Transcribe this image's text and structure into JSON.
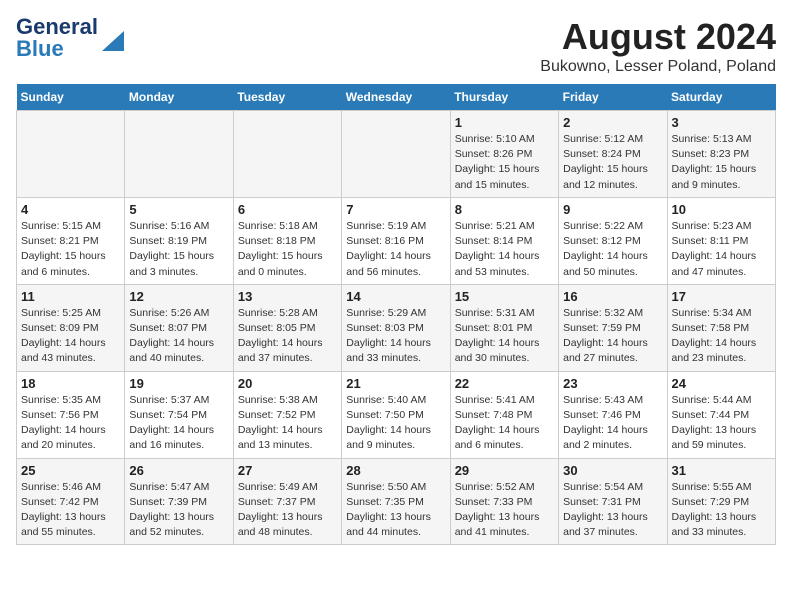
{
  "header": {
    "logo_line1": "General",
    "logo_line2": "Blue",
    "title": "August 2024",
    "subtitle": "Bukowno, Lesser Poland, Poland"
  },
  "weekdays": [
    "Sunday",
    "Monday",
    "Tuesday",
    "Wednesday",
    "Thursday",
    "Friday",
    "Saturday"
  ],
  "weeks": [
    [
      {
        "day": "",
        "info": ""
      },
      {
        "day": "",
        "info": ""
      },
      {
        "day": "",
        "info": ""
      },
      {
        "day": "",
        "info": ""
      },
      {
        "day": "1",
        "info": "Sunrise: 5:10 AM\nSunset: 8:26 PM\nDaylight: 15 hours\nand 15 minutes."
      },
      {
        "day": "2",
        "info": "Sunrise: 5:12 AM\nSunset: 8:24 PM\nDaylight: 15 hours\nand 12 minutes."
      },
      {
        "day": "3",
        "info": "Sunrise: 5:13 AM\nSunset: 8:23 PM\nDaylight: 15 hours\nand 9 minutes."
      }
    ],
    [
      {
        "day": "4",
        "info": "Sunrise: 5:15 AM\nSunset: 8:21 PM\nDaylight: 15 hours\nand 6 minutes."
      },
      {
        "day": "5",
        "info": "Sunrise: 5:16 AM\nSunset: 8:19 PM\nDaylight: 15 hours\nand 3 minutes."
      },
      {
        "day": "6",
        "info": "Sunrise: 5:18 AM\nSunset: 8:18 PM\nDaylight: 15 hours\nand 0 minutes."
      },
      {
        "day": "7",
        "info": "Sunrise: 5:19 AM\nSunset: 8:16 PM\nDaylight: 14 hours\nand 56 minutes."
      },
      {
        "day": "8",
        "info": "Sunrise: 5:21 AM\nSunset: 8:14 PM\nDaylight: 14 hours\nand 53 minutes."
      },
      {
        "day": "9",
        "info": "Sunrise: 5:22 AM\nSunset: 8:12 PM\nDaylight: 14 hours\nand 50 minutes."
      },
      {
        "day": "10",
        "info": "Sunrise: 5:23 AM\nSunset: 8:11 PM\nDaylight: 14 hours\nand 47 minutes."
      }
    ],
    [
      {
        "day": "11",
        "info": "Sunrise: 5:25 AM\nSunset: 8:09 PM\nDaylight: 14 hours\nand 43 minutes."
      },
      {
        "day": "12",
        "info": "Sunrise: 5:26 AM\nSunset: 8:07 PM\nDaylight: 14 hours\nand 40 minutes."
      },
      {
        "day": "13",
        "info": "Sunrise: 5:28 AM\nSunset: 8:05 PM\nDaylight: 14 hours\nand 37 minutes."
      },
      {
        "day": "14",
        "info": "Sunrise: 5:29 AM\nSunset: 8:03 PM\nDaylight: 14 hours\nand 33 minutes."
      },
      {
        "day": "15",
        "info": "Sunrise: 5:31 AM\nSunset: 8:01 PM\nDaylight: 14 hours\nand 30 minutes."
      },
      {
        "day": "16",
        "info": "Sunrise: 5:32 AM\nSunset: 7:59 PM\nDaylight: 14 hours\nand 27 minutes."
      },
      {
        "day": "17",
        "info": "Sunrise: 5:34 AM\nSunset: 7:58 PM\nDaylight: 14 hours\nand 23 minutes."
      }
    ],
    [
      {
        "day": "18",
        "info": "Sunrise: 5:35 AM\nSunset: 7:56 PM\nDaylight: 14 hours\nand 20 minutes."
      },
      {
        "day": "19",
        "info": "Sunrise: 5:37 AM\nSunset: 7:54 PM\nDaylight: 14 hours\nand 16 minutes."
      },
      {
        "day": "20",
        "info": "Sunrise: 5:38 AM\nSunset: 7:52 PM\nDaylight: 14 hours\nand 13 minutes."
      },
      {
        "day": "21",
        "info": "Sunrise: 5:40 AM\nSunset: 7:50 PM\nDaylight: 14 hours\nand 9 minutes."
      },
      {
        "day": "22",
        "info": "Sunrise: 5:41 AM\nSunset: 7:48 PM\nDaylight: 14 hours\nand 6 minutes."
      },
      {
        "day": "23",
        "info": "Sunrise: 5:43 AM\nSunset: 7:46 PM\nDaylight: 14 hours\nand 2 minutes."
      },
      {
        "day": "24",
        "info": "Sunrise: 5:44 AM\nSunset: 7:44 PM\nDaylight: 13 hours\nand 59 minutes."
      }
    ],
    [
      {
        "day": "25",
        "info": "Sunrise: 5:46 AM\nSunset: 7:42 PM\nDaylight: 13 hours\nand 55 minutes."
      },
      {
        "day": "26",
        "info": "Sunrise: 5:47 AM\nSunset: 7:39 PM\nDaylight: 13 hours\nand 52 minutes."
      },
      {
        "day": "27",
        "info": "Sunrise: 5:49 AM\nSunset: 7:37 PM\nDaylight: 13 hours\nand 48 minutes."
      },
      {
        "day": "28",
        "info": "Sunrise: 5:50 AM\nSunset: 7:35 PM\nDaylight: 13 hours\nand 44 minutes."
      },
      {
        "day": "29",
        "info": "Sunrise: 5:52 AM\nSunset: 7:33 PM\nDaylight: 13 hours\nand 41 minutes."
      },
      {
        "day": "30",
        "info": "Sunrise: 5:54 AM\nSunset: 7:31 PM\nDaylight: 13 hours\nand 37 minutes."
      },
      {
        "day": "31",
        "info": "Sunrise: 5:55 AM\nSunset: 7:29 PM\nDaylight: 13 hours\nand 33 minutes."
      }
    ]
  ]
}
